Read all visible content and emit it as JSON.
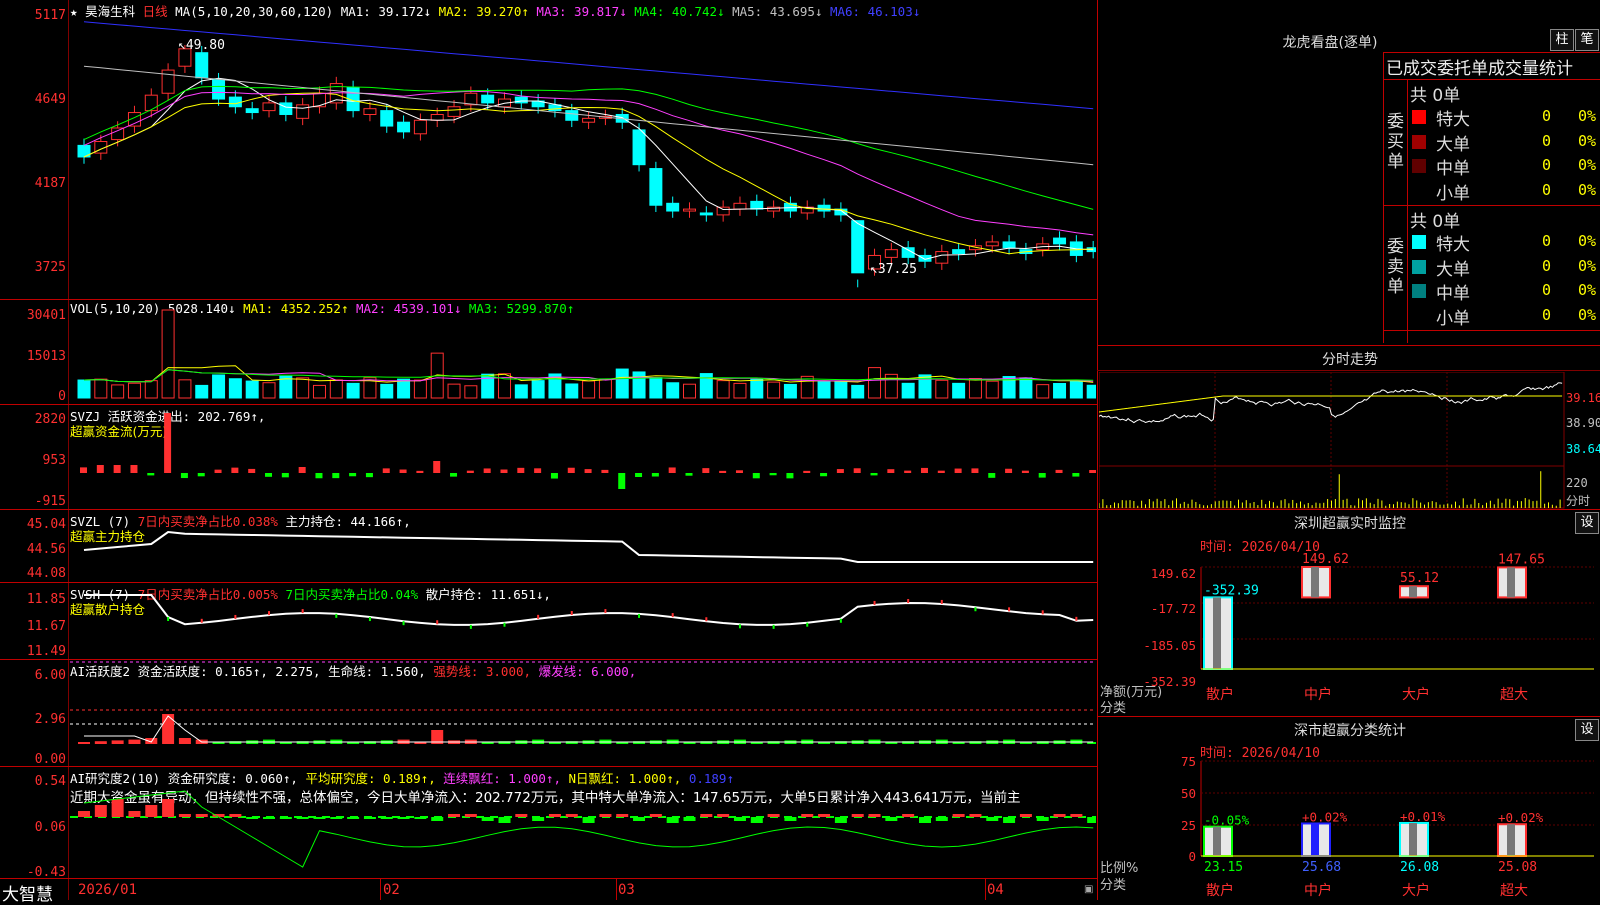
{
  "colors": {
    "up": "#ff3030",
    "down": "#00ffff",
    "ma1": "#ffffff",
    "ma2": "#ffff00",
    "ma3": "#ff40ff",
    "ma4": "#00ff00",
    "ma5": "#c0c0c0",
    "ma6": "#3030ff",
    "grid": "#c00000"
  },
  "header": {
    "star": "★",
    "stock": "昊海生科",
    "period": "日线",
    "ma_def": "MA(5,10,20,30,60,120)",
    "ma1": "MA1: 39.172↓",
    "ma2": "MA2: 39.270↑",
    "ma3": "MA3: 39.817↓",
    "ma4": "MA4: 40.742↓",
    "ma5": "MA5: 43.695↓",
    "ma6": "MA6: 46.103↓"
  },
  "price_axis": [
    "5117",
    "4649",
    "4187",
    "3725"
  ],
  "price_annotations": {
    "high": "49.80",
    "low": "37.25"
  },
  "vol": {
    "axis": [
      "30401",
      "15013",
      "0"
    ],
    "label": "VOL(5,10,20)",
    "value": "5028.140↓",
    "ma1": "MA1: 4352.252↑",
    "ma2": "MA2: 4539.101↓",
    "ma3": "MA3: 5299.870↑"
  },
  "svzj": {
    "axis": [
      "2820",
      "953",
      "-915"
    ],
    "label": "SVZJ  活跃资金进出: 202.769↑,",
    "sub": "超赢资金流(万元)"
  },
  "svzl": {
    "axis": [
      "45.04",
      "44.56",
      "44.08"
    ],
    "label": "SVZL (7)",
    "t1": "7日内买卖净占比0.038%",
    "t2": "主力持仓: 44.166↑,",
    "sub": "超赢主力持仓"
  },
  "svsh": {
    "axis": [
      "11.85",
      "11.67",
      "11.49"
    ],
    "label": "SVSH (7)",
    "t1": "7日内买卖净占比0.005%",
    "t2": "7日内买卖净占比0.04%",
    "t3": "散户持仓: 11.651↓,",
    "sub": "超赢散户持仓"
  },
  "ai1": {
    "axis": [
      "6.00",
      "2.96",
      "0.00"
    ],
    "label": "AI活跃度2",
    "t1": "资金活跃度: 0.165↑,",
    "t2": "2.275,",
    "t3": "生命线: 1.560,",
    "t4": "强势线: 3.000,",
    "t5": "爆发线: 6.000,"
  },
  "ai2": {
    "axis": [
      "0.54",
      "0.06",
      "-0.43"
    ],
    "label": "AI研究度2(10)",
    "t1": "资金研究度: 0.060↑,",
    "t2": "平均研究度: 0.189↑,",
    "t3": "连续飘红: 1.000↑,",
    "t4": "N日飘红: 1.000↑,",
    "t5": "0.189↑",
    "note": "近期大资金虽有异动，但持续性不强，总体偏空，今日大单净流入：202.772万元，其中特大单净流入：147.65万元，大单5日累计净入443.641万元，当前主"
  },
  "xaxis": {
    "brand": "大智慧",
    "labels": [
      "2026/01",
      "02",
      "03",
      "04"
    ]
  },
  "right": {
    "lhb_title": "龙虎看盘(逐单)",
    "btn_zhu": "柱",
    "btn_bi": "笔",
    "stats_title": "已成交委托单成交量统计",
    "buy_side": "委买单",
    "sell_side": "委卖单",
    "buy_total": "共 0单",
    "sell_total": "共 0单",
    "buy_rows": [
      {
        "name": "特大",
        "val": "0",
        "pct": "0%",
        "color": "#ff0000"
      },
      {
        "name": "大单",
        "val": "0",
        "pct": "0%",
        "color": "#a00000"
      },
      {
        "name": "中单",
        "val": "0",
        "pct": "0%",
        "color": "#600000"
      },
      {
        "name": "小单",
        "val": "0",
        "pct": "0%",
        "color": ""
      }
    ],
    "sell_rows": [
      {
        "name": "特大",
        "val": "0",
        "pct": "0%",
        "color": "#00ffff"
      },
      {
        "name": "大单",
        "val": "0",
        "pct": "0%",
        "color": "#00a0a0"
      },
      {
        "name": "中单",
        "val": "0",
        "pct": "0%",
        "color": "#008080"
      },
      {
        "name": "小单",
        "val": "0",
        "pct": "0%",
        "color": ""
      }
    ],
    "fenshi_title": "分时走势",
    "fenshi_axis": [
      "39.16",
      "38.90",
      "38.64"
    ],
    "fenshi_vol_axis": [
      "220",
      "分时"
    ],
    "sz_title": "深圳超赢实时监控",
    "sz_btn": "设",
    "sz_time": "时间: 2026/04/10",
    "sz_axis": [
      "149.62",
      "-17.72",
      "-185.05",
      "-352.39"
    ],
    "sz_ylabel": "净额(万元)",
    "sz_xlabel": "分类",
    "sz_cats": [
      "散户",
      "中户",
      "大户",
      "超大"
    ],
    "sz_values": [
      "-352.39",
      "149.62",
      "55.12",
      "147.65"
    ],
    "fl_title": "深市超赢分类统计",
    "fl_btn": "设",
    "fl_time": "时间: 2026/04/10",
    "fl_axis": [
      "75",
      "50",
      "25",
      "0"
    ],
    "fl_ylabel": "比例%",
    "fl_xlabel": "分类",
    "fl_cats": [
      "散户",
      "中户",
      "大户",
      "超大"
    ],
    "fl_changes": [
      "-0.05%",
      "+0.02%",
      "+0.01%",
      "+0.02%"
    ],
    "fl_values": [
      "23.15",
      "25.68",
      "26.08",
      "25.08"
    ]
  }
}
